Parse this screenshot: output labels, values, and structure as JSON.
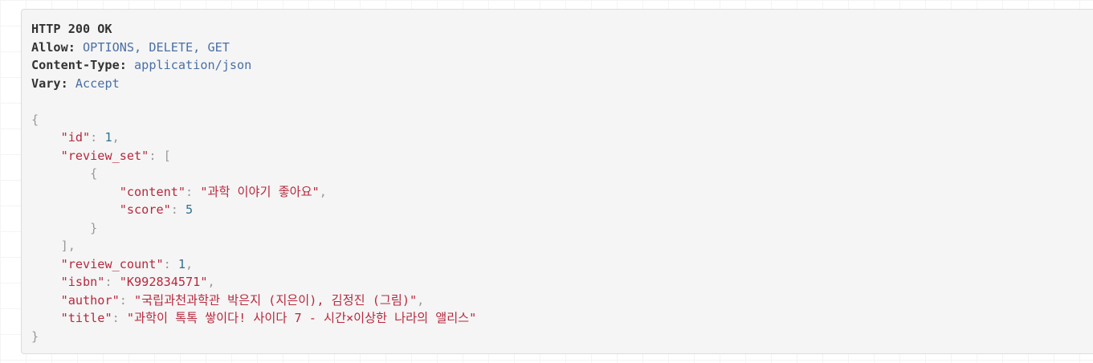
{
  "response": {
    "status_line": "HTTP 200 OK",
    "headers": [
      {
        "name": "Allow:",
        "value": "OPTIONS, DELETE, GET"
      },
      {
        "name": "Content-Type:",
        "value": "application/json"
      },
      {
        "name": "Vary:",
        "value": "Accept"
      }
    ]
  },
  "json_body": {
    "open_brace": "{",
    "close_brace": "}",
    "id": {
      "key": "\"id\"",
      "value": "1"
    },
    "review_set": {
      "key": "\"review_set\"",
      "open_bracket": "[",
      "close_bracket": "],",
      "items": [
        {
          "open_brace": "{",
          "close_brace": "}",
          "content": {
            "key": "\"content\"",
            "value": "\"과학 이야기 좋아요\""
          },
          "score": {
            "key": "\"score\"",
            "value": "5"
          }
        }
      ]
    },
    "review_count": {
      "key": "\"review_count\"",
      "value": "1"
    },
    "isbn": {
      "key": "\"isbn\"",
      "value": "\"K992834571\""
    },
    "author": {
      "key": "\"author\"",
      "value": "\"국립과천과학관 박은지 (지은이), 김정진 (그림)\""
    },
    "title": {
      "key": "\"title\"",
      "value": "\"과학이 톡톡 쌓이다! 사이다 7 - 시간×이상한 나라의 앨리스\""
    }
  },
  "colors": {
    "key": "#b8283d",
    "string": "#b8283d",
    "number": "#31708f",
    "punctuation": "#999999",
    "header_value": "#4a6fa5",
    "panel_background": "#f5f5f5"
  }
}
